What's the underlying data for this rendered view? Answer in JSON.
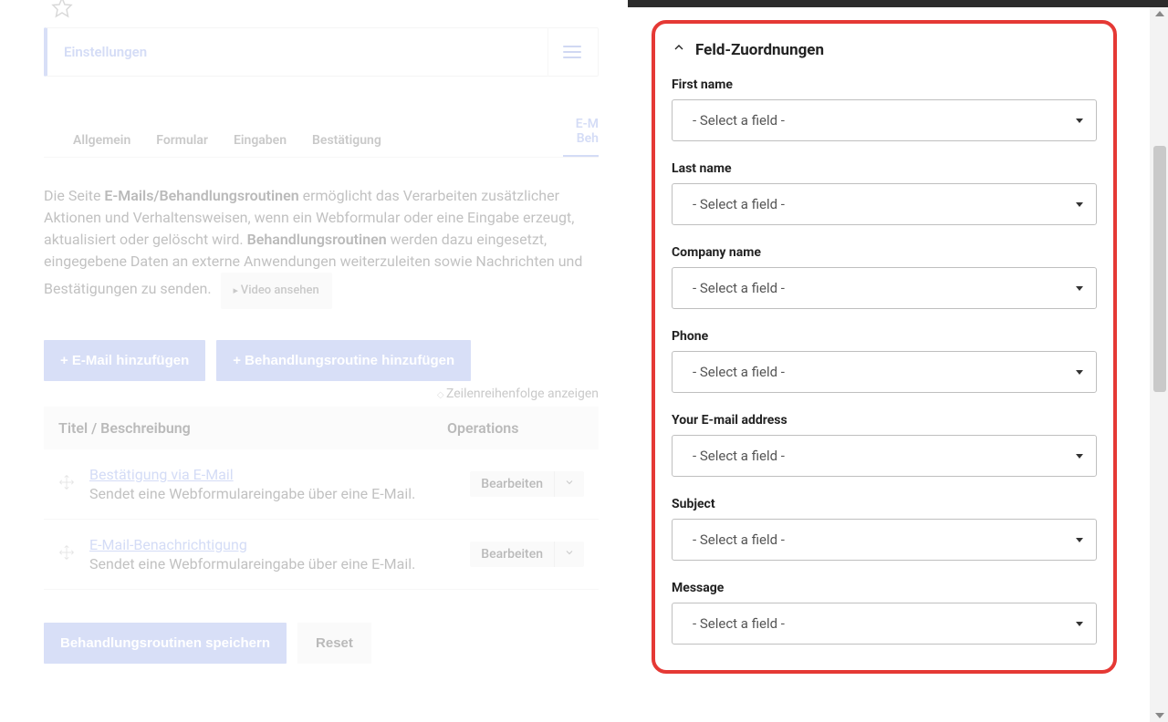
{
  "left": {
    "settings_title": "Einstellungen",
    "tabs": [
      {
        "label": "Allgemein"
      },
      {
        "label": "Formular"
      },
      {
        "label": "Eingaben"
      },
      {
        "label": "Bestätigung"
      },
      {
        "label_l1": "E-M",
        "label_l2": "Beh",
        "active": true
      }
    ],
    "intro_p1a": "Die Seite ",
    "intro_b1": "E-Mails/Behandlungsroutinen",
    "intro_p1b": " ermöglicht das Verarbeiten zusätzlicher Aktionen und Verhaltensweisen, wenn ein Webformular oder eine Eingabe erzeugt, aktualisiert oder gelöscht wird. ",
    "intro_b2": "Behandlungsroutinen",
    "intro_p1c": " werden dazu eingesetzt, eingegebene Daten an externe Anwendungen weiterzuleiten sowie Nachrichten und Bestätigungen zu senden.",
    "video_btn": "Video ansehen",
    "add_email": "+ E-Mail hinzufügen",
    "add_handler": "+ Behandlungsroutine hinzufügen",
    "row_order": "Zeilenreihenfolge anzeigen",
    "th_title": "Titel / Beschreibung",
    "th_ops": "Operations",
    "rows": [
      {
        "title": "Bestätigung via E-Mail",
        "desc": "Sendet eine Webformulareingabe über eine E-Mail.",
        "op": "Bearbeiten"
      },
      {
        "title": "E-Mail-Benachrichtigung",
        "desc": "Sendet eine Webformulareingabe über eine E-Mail.",
        "op": "Bearbeiten"
      }
    ],
    "save_btn": "Behandlungsroutinen speichern",
    "reset_btn": "Reset"
  },
  "right": {
    "section_title": "Feld-Zuordnungen",
    "placeholder": "- Select a field -",
    "fields": [
      {
        "label": "First name"
      },
      {
        "label": "Last name"
      },
      {
        "label": "Company name"
      },
      {
        "label": "Phone"
      },
      {
        "label": "Your E-mail address"
      },
      {
        "label": "Subject"
      },
      {
        "label": "Message"
      }
    ]
  }
}
